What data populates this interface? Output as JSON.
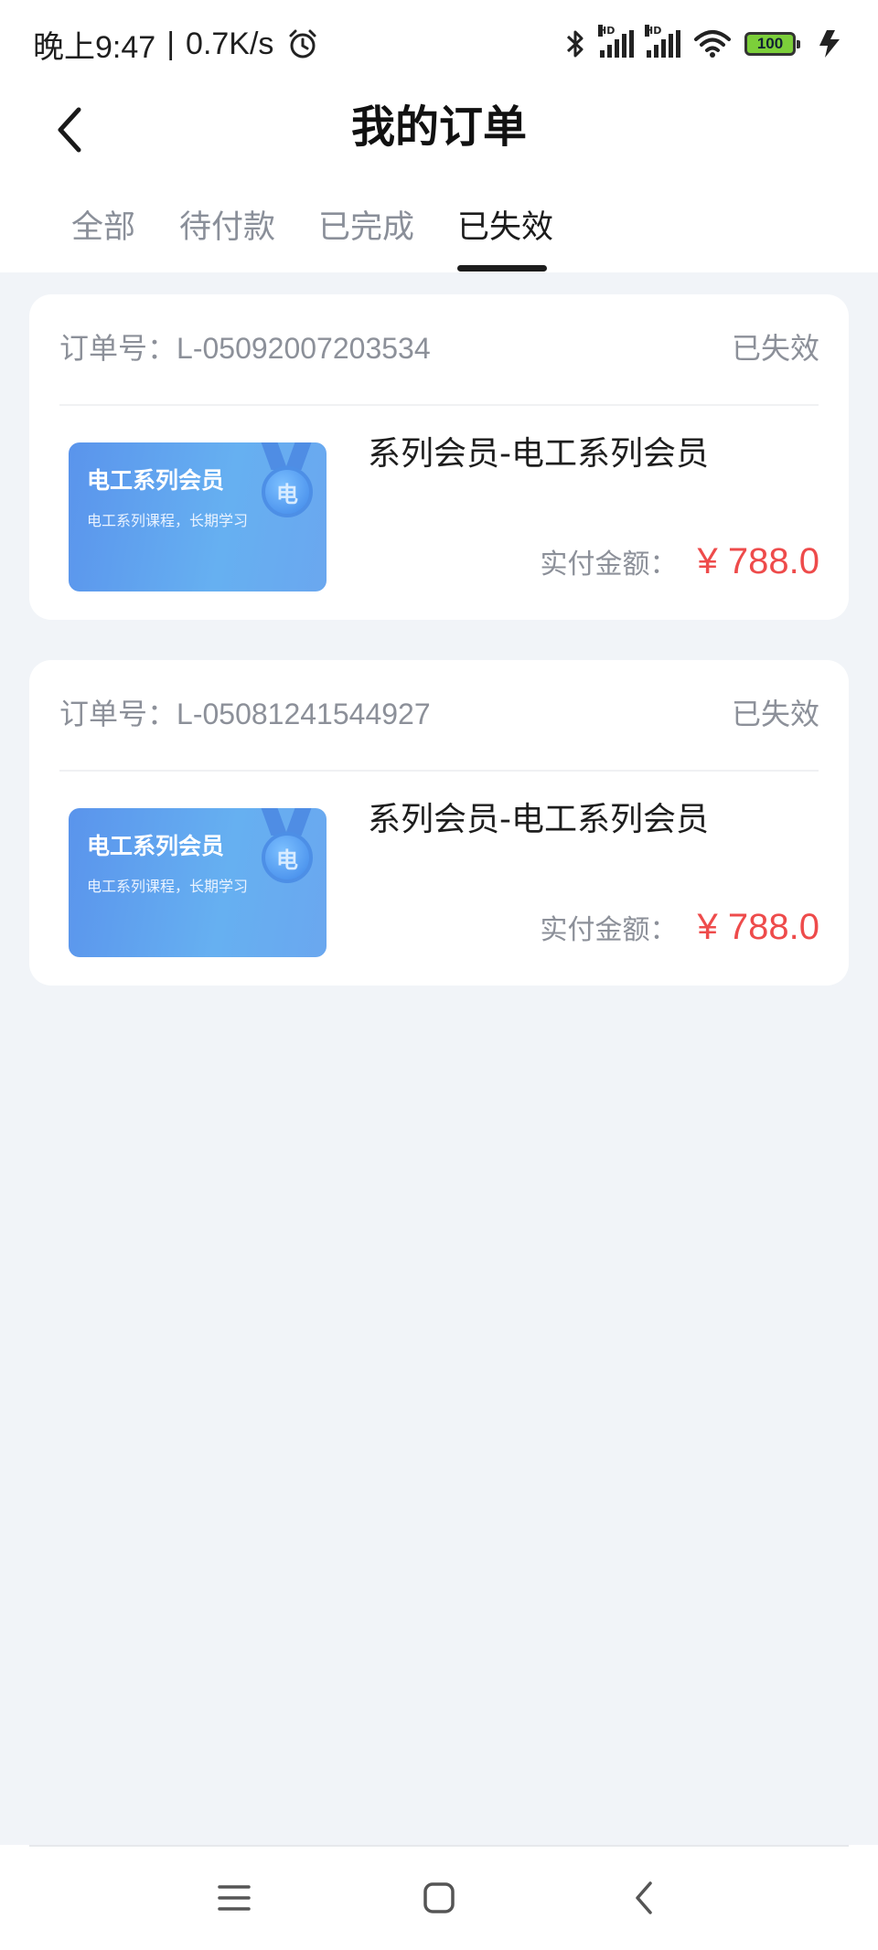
{
  "status_bar": {
    "time": "晚上9:47",
    "separator": "|",
    "speed": "0.7K/s",
    "network_label": "HD",
    "battery": "100"
  },
  "header": {
    "title": "我的订单"
  },
  "tabs": [
    {
      "label": "全部",
      "active": false
    },
    {
      "label": "待付款",
      "active": false
    },
    {
      "label": "已完成",
      "active": false
    },
    {
      "label": "已失效",
      "active": true
    }
  ],
  "orders": [
    {
      "order_label": "订单号：",
      "order_no": "L-05092007203534",
      "status": "已失效",
      "thumb_title": "电工系列会员",
      "thumb_subtitle": "电工系列课程，长期学习",
      "thumb_badge": "电",
      "product_name": "系列会员-电工系列会员",
      "pay_label": "实付金额：",
      "amount": "¥ 788.0"
    },
    {
      "order_label": "订单号：",
      "order_no": "L-05081241544927",
      "status": "已失效",
      "thumb_title": "电工系列会员",
      "thumb_subtitle": "电工系列课程，长期学习",
      "thumb_badge": "电",
      "product_name": "系列会员-电工系列会员",
      "pay_label": "实付金额：",
      "amount": "¥ 788.0"
    }
  ],
  "colors": {
    "background": "#f1f4f8",
    "price": "#ee4b4b",
    "muted_text": "#8c9099",
    "thumb_blue": "#5a94ec"
  },
  "icons": {
    "back": "chevron-left-icon",
    "alarm": "alarm-icon",
    "bluetooth": "bluetooth-icon",
    "wifi": "wifi-icon",
    "charging": "lightning-icon",
    "nav_menu": "menu-icon",
    "nav_home": "home-square-icon",
    "nav_back": "back-triangle-icon"
  }
}
